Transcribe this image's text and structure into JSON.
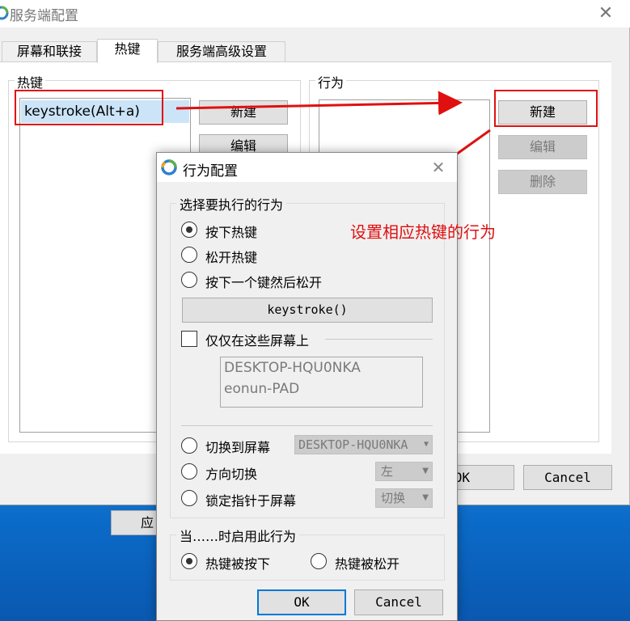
{
  "main_window": {
    "title": "服务端配置",
    "tabs": [
      {
        "label": "屏幕和联接"
      },
      {
        "label": "热键"
      },
      {
        "label": "服务端高级设置"
      }
    ],
    "hotkeys_group": {
      "label": "热键",
      "selected_item": "keystroke(Alt+a)",
      "new_button": "新建",
      "edit_button": "编辑"
    },
    "actions_group": {
      "label": "行为",
      "new_button": "新建",
      "edit_button": "编辑",
      "delete_button": "删除"
    },
    "ok_button": "OK",
    "cancel_button": "Cancel",
    "apply_button": "应"
  },
  "dialog": {
    "title": "行为配置",
    "select_action_group": {
      "label": "选择要执行的行为",
      "options": [
        {
          "label": "按下热键",
          "checked": true
        },
        {
          "label": "松开热键",
          "checked": false
        },
        {
          "label": "按下一个键然后松开",
          "checked": false
        }
      ],
      "keystroke_button": "keystroke()",
      "only_screens_label": "仅仅在这些屏幕上",
      "only_screens_checked": false,
      "screens": [
        "DESKTOP-HQU0NKA",
        "eonun-PAD"
      ],
      "switch_to_screen": {
        "label": "切换到屏幕",
        "value": "DESKTOP-HQU0NKA"
      },
      "direction_switch": {
        "label": "方向切换",
        "value": "左"
      },
      "lock_cursor": {
        "label": "锁定指针于屏幕",
        "value": "切换"
      }
    },
    "when_group": {
      "label": "当……时启用此行为",
      "options": [
        {
          "label": "热键被按下",
          "checked": true
        },
        {
          "label": "热键被松开",
          "checked": false
        }
      ]
    },
    "ok_button": "OK",
    "cancel_button": "Cancel"
  },
  "annotation": {
    "text": "设置相应热键的行为",
    "color": "#e01010"
  },
  "colors": {
    "accent": "#0078d7",
    "annotation_red": "#e01010",
    "desktop_blue": "#0b5fb0"
  }
}
